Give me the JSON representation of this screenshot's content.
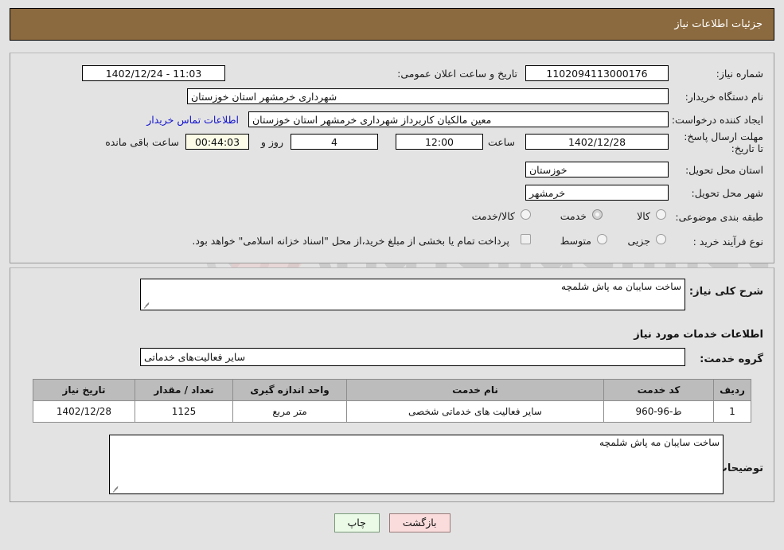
{
  "header": {
    "title": "جزئیات اطلاعات نیاز"
  },
  "top_panel": {
    "need_number_label": "شماره نیاز:",
    "need_number_value": "1102094113000176",
    "announce_label": "تاریخ و ساعت اعلان عمومی:",
    "announce_value": "11:03 - 1402/12/24",
    "buyer_org_label": "نام دستگاه خریدار:",
    "buyer_org_value": "شهرداری خرمشهر استان خوزستان",
    "creator_label": "ایجاد کننده درخواست:",
    "creator_value": "معین مالکیان کاربرداز شهرداری خرمشهر استان خوزستان",
    "contact_link": "اطلاعات تماس خریدار",
    "deadline_label": "مهلت ارسال پاسخ: تا تاریخ:",
    "deadline_date": "1402/12/28",
    "hour_label": "ساعت",
    "hour_value": "12:00",
    "days_value": "4",
    "days_label": "روز و",
    "remaining_value": "00:44:03",
    "remaining_label": "ساعت باقی مانده",
    "province_label": "استان محل تحویل:",
    "province_value": "خوزستان",
    "city_label": "شهر محل تحویل:",
    "city_value": "خرمشهر",
    "category_label": "طبقه بندی موضوعی:",
    "category_options": [
      {
        "label": "کالا",
        "checked": false
      },
      {
        "label": "خدمت",
        "checked": true
      },
      {
        "label": "کالا/خدمت",
        "checked": false
      }
    ],
    "process_label": "نوع فرآیند خرید :",
    "process_options": [
      {
        "label": "جزیی",
        "checked": true
      },
      {
        "label": "متوسط",
        "checked": false
      }
    ],
    "treasury_checkbox_checked": false,
    "treasury_note": "پرداخت تمام یا بخشی از مبلغ خرید،از محل \"اسناد خزانه اسلامی\" خواهد بود."
  },
  "mid_panel": {
    "general_desc_label": "شرح کلی نیاز:",
    "general_desc_value": "ساخت سایبان مه پاش شلمچه",
    "services_heading": "اطلاعات خدمات مورد نیاز",
    "service_group_label": "گروه خدمت:",
    "service_group_value": "سایر فعالیت‌های خدماتی",
    "table": {
      "columns": [
        "ردیف",
        "کد خدمت",
        "نام خدمت",
        "واحد اندازه گیری",
        "تعداد / مقدار",
        "تاریخ نیاز"
      ],
      "rows": [
        [
          "1",
          "ط-96-960",
          "سایر فعالیت های خدماتی شخصی",
          "متر مربع",
          "1125",
          "1402/12/28"
        ]
      ]
    },
    "buyer_notes_label": "توضیحات خریدار:",
    "buyer_notes_value": "ساخت سایبان مه پاش شلمچه"
  },
  "footer": {
    "print_button": "چاپ",
    "back_button": "بازگشت"
  },
  "watermark": {
    "text": "AriaTender.net"
  },
  "colors": {
    "header_bg": "#8b6a3f",
    "page_bg": "#e3e3e3",
    "link": "#1414cf",
    "table_header_bg": "#bcbcbc",
    "back_button_bg": "#fadcdc",
    "print_button_bg": "#eafae6",
    "countdown_bg": "#fbfbe8"
  }
}
